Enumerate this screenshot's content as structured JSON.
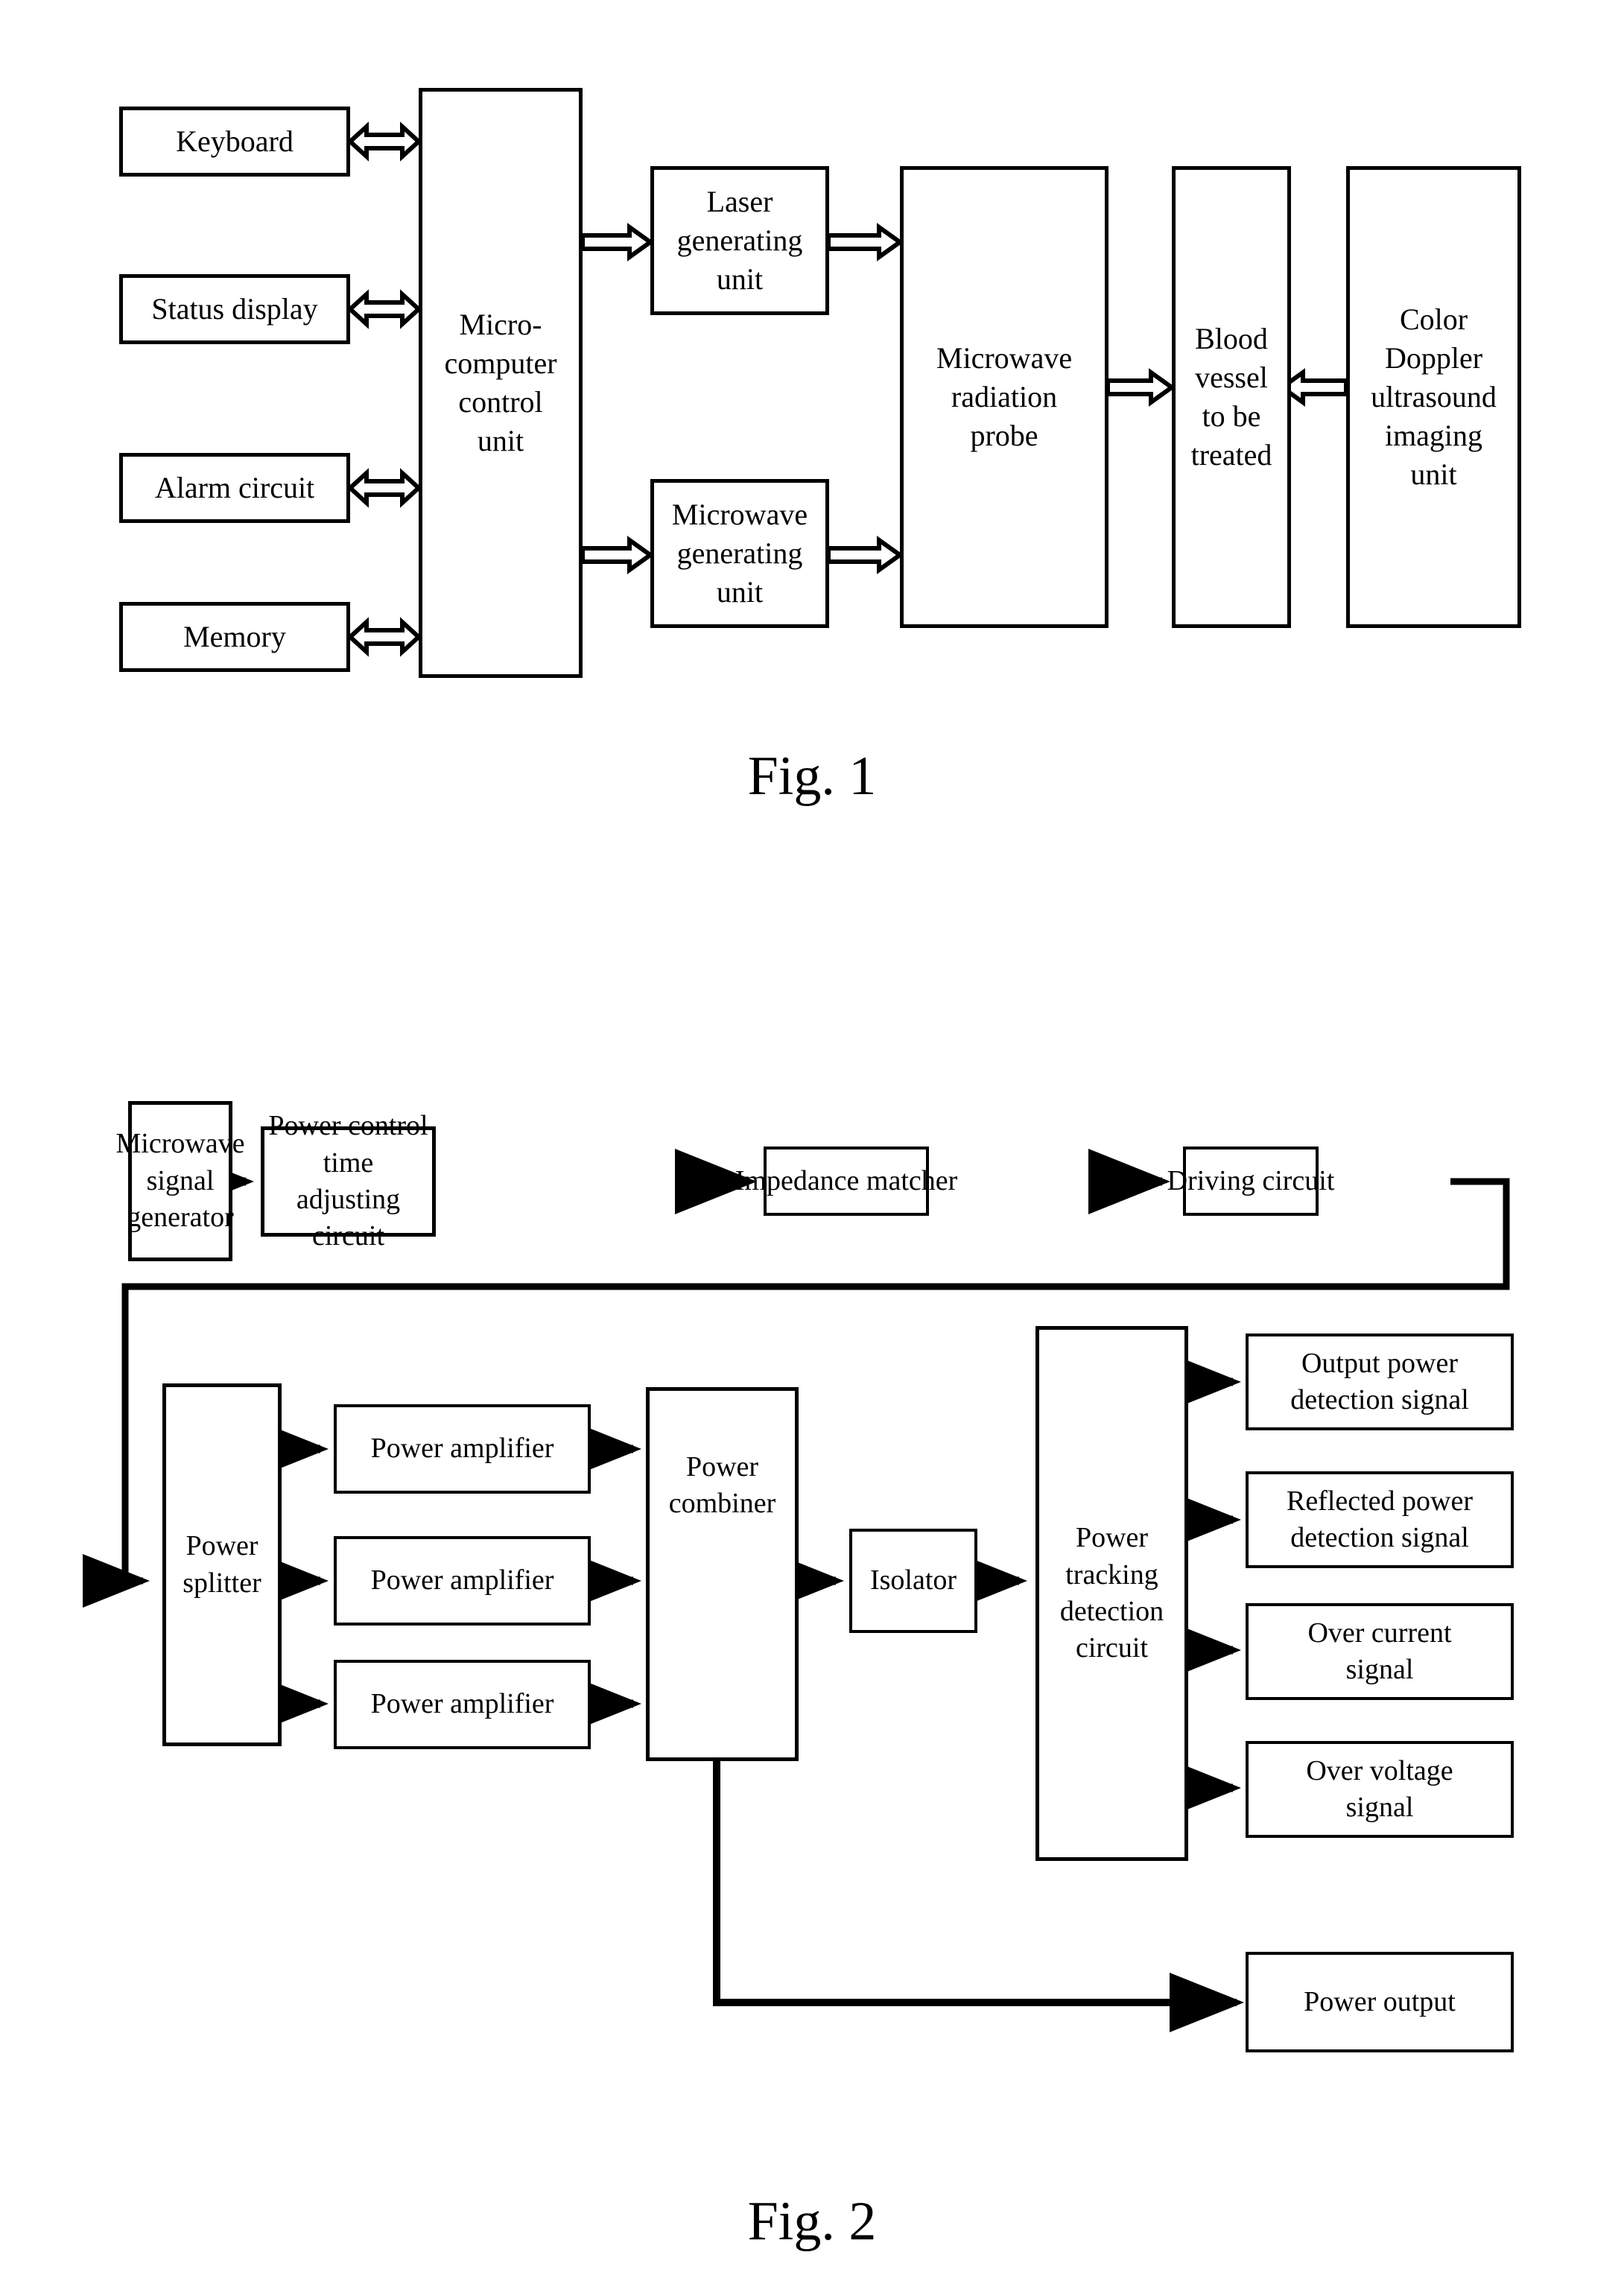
{
  "figure1": {
    "caption": "Fig. 1",
    "blocks": {
      "keyboard": "Keyboard",
      "status_display": "Status display",
      "alarm_circuit": "Alarm circuit",
      "memory": "Memory",
      "micro_computer_control_unit": "Micro-\ncomputer\ncontrol\nunit",
      "laser_generating_unit": "Laser\ngenerating\nunit",
      "microwave_generating_unit": "Microwave\ngenerating\nunit",
      "microwave_radiation_probe": "Microwave\nradiation\nprobe",
      "blood_vessel_to_be_treated": "Blood\nvessel\nto be\ntreated",
      "color_doppler_ultrasound_imaging_unit": "Color\nDoppler\nultrasound\nimaging\nunit"
    },
    "connections": [
      {
        "from": "keyboard",
        "to": "micro_computer_control_unit",
        "style": "double-headed-open"
      },
      {
        "from": "status_display",
        "to": "micro_computer_control_unit",
        "style": "double-headed-open"
      },
      {
        "from": "alarm_circuit",
        "to": "micro_computer_control_unit",
        "style": "double-headed-open"
      },
      {
        "from": "memory",
        "to": "micro_computer_control_unit",
        "style": "double-headed-open"
      },
      {
        "from": "micro_computer_control_unit",
        "to": "laser_generating_unit",
        "style": "open-arrow"
      },
      {
        "from": "micro_computer_control_unit",
        "to": "microwave_generating_unit",
        "style": "open-arrow"
      },
      {
        "from": "laser_generating_unit",
        "to": "microwave_radiation_probe",
        "style": "open-arrow"
      },
      {
        "from": "microwave_generating_unit",
        "to": "microwave_radiation_probe",
        "style": "open-arrow"
      },
      {
        "from": "microwave_radiation_probe",
        "to": "blood_vessel_to_be_treated",
        "style": "open-arrow"
      },
      {
        "from": "color_doppler_ultrasound_imaging_unit",
        "to": "blood_vessel_to_be_treated",
        "style": "open-arrow"
      }
    ]
  },
  "figure2": {
    "caption": "Fig. 2",
    "blocks": {
      "microwave_signal_generator": "Microwave\nsignal\ngenerator",
      "power_control_time_adjusting_circuit": "Power control time\nadjusting circuit",
      "impedance_matcher": "Impedance matcher",
      "driving_circuit": "Driving circuit",
      "power_splitter": "Power\nsplitter",
      "power_amplifier_1": "Power amplifier",
      "power_amplifier_2": "Power amplifier",
      "power_amplifier_3": "Power amplifier",
      "power_combiner": "Power\ncombiner",
      "isolator": "Isolator",
      "power_tracking_detection_circuit": "Power\ntracking\ndetection\ncircuit",
      "output_power_detection_signal": "Output power\ndetection signal",
      "reflected_power_detection_signal": "Reflected power\ndetection signal",
      "over_current_signal": "Over current\nsignal",
      "over_voltage_signal": "Over voltage\nsignal",
      "power_output": "Power output"
    },
    "connections": [
      {
        "from": "microwave_signal_generator",
        "to": "power_control_time_adjusting_circuit",
        "style": "solid-arrow"
      },
      {
        "from": "power_control_time_adjusting_circuit",
        "to": "impedance_matcher",
        "style": "solid-arrow"
      },
      {
        "from": "impedance_matcher",
        "to": "driving_circuit",
        "style": "solid-arrow"
      },
      {
        "from": "driving_circuit",
        "to": "power_splitter",
        "style": "solid-arrow-routed"
      },
      {
        "from": "power_splitter",
        "to": "power_amplifier_1",
        "style": "solid-arrow"
      },
      {
        "from": "power_splitter",
        "to": "power_amplifier_2",
        "style": "solid-arrow"
      },
      {
        "from": "power_splitter",
        "to": "power_amplifier_3",
        "style": "solid-arrow"
      },
      {
        "from": "power_amplifier_1",
        "to": "power_combiner",
        "style": "solid-arrow"
      },
      {
        "from": "power_amplifier_2",
        "to": "power_combiner",
        "style": "solid-arrow"
      },
      {
        "from": "power_amplifier_3",
        "to": "power_combiner",
        "style": "solid-arrow"
      },
      {
        "from": "power_combiner",
        "to": "isolator",
        "style": "solid-arrow"
      },
      {
        "from": "isolator",
        "to": "power_tracking_detection_circuit",
        "style": "solid-arrow"
      },
      {
        "from": "power_tracking_detection_circuit",
        "to": "output_power_detection_signal",
        "style": "solid-arrow"
      },
      {
        "from": "power_tracking_detection_circuit",
        "to": "reflected_power_detection_signal",
        "style": "solid-arrow"
      },
      {
        "from": "power_tracking_detection_circuit",
        "to": "over_current_signal",
        "style": "solid-arrow"
      },
      {
        "from": "power_tracking_detection_circuit",
        "to": "over_voltage_signal",
        "style": "solid-arrow"
      },
      {
        "from": "power_combiner",
        "to": "power_output",
        "style": "solid-arrow-routed"
      }
    ]
  },
  "colors": {
    "line": "#000000",
    "background": "#ffffff",
    "text": "#000000"
  }
}
